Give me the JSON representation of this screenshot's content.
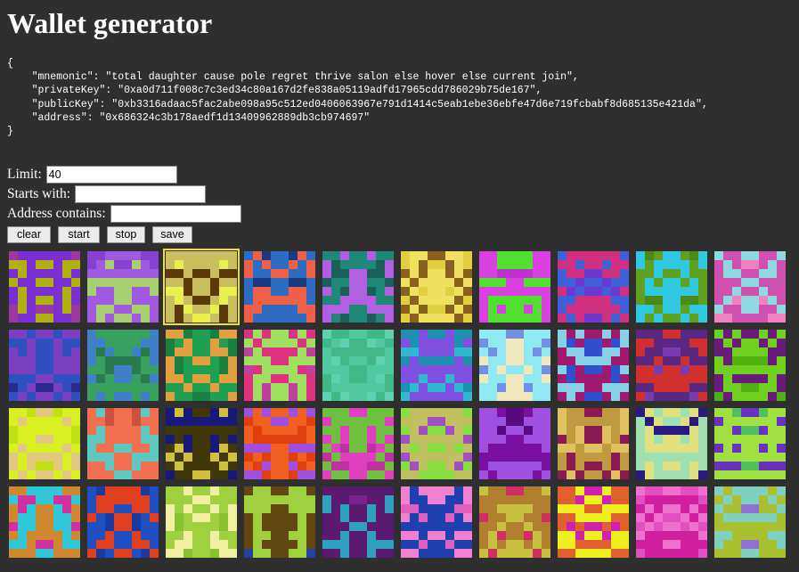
{
  "title": "Wallet generator",
  "wallet": {
    "mnemonic": "total daughter cause pole regret thrive salon else hover else current join",
    "privateKey": "0xa0d711f008c7c3ed34c80a167d2fe838a05119adfd17965cdd786029b75de167",
    "publicKey": "0xb3316adaac5fac2abe098a95c512ed0406063967e791d1414c5eab1ebe36ebfe47d6e719fcbabf8d685135e421da",
    "address": "0x686324c3b178aedf1d13409962889db3cb974697"
  },
  "form": {
    "limit_label": "Limit:",
    "limit_value": "40",
    "starts_label": "Starts with:",
    "starts_value": "",
    "contains_label": "Address contains:",
    "contains_value": ""
  },
  "buttons": {
    "clear": "clear",
    "start": "start",
    "stop": "stop",
    "save": "save"
  },
  "identicons": {
    "selected_index": 2,
    "selected_color": "#f0e020",
    "tiles": [
      {
        "c": [
          "#7a2fd0",
          "#b0b010",
          "#9a3aa0"
        ]
      },
      {
        "c": [
          "#a05ae0",
          "#a8d070",
          "#8840d0"
        ]
      },
      {
        "c": [
          "#c8c060",
          "#5a3a08",
          "#e8f050"
        ]
      },
      {
        "c": [
          "#2d6cc0",
          "#f06048",
          "#1a3a80"
        ]
      },
      {
        "c": [
          "#208878",
          "#b060e0",
          "#1a6058"
        ]
      },
      {
        "c": [
          "#e0d040",
          "#f0e060",
          "#8a6020"
        ]
      },
      {
        "c": [
          "#d840e0",
          "#50e030",
          "#c030d0"
        ]
      },
      {
        "c": [
          "#4060d8",
          "#d03080",
          "#6a3ad0"
        ]
      },
      {
        "c": [
          "#60a020",
          "#30c8e0",
          "#4a8a18"
        ]
      },
      {
        "c": [
          "#d050b0",
          "#90d8e0",
          "#f080c0"
        ]
      },
      {
        "c": [
          "#3050c0",
          "#7a40c0",
          "#2a2a90"
        ]
      },
      {
        "c": [
          "#3aa060",
          "#4080c8",
          "#2a7a50"
        ]
      },
      {
        "c": [
          "#20a050",
          "#e0a040",
          "#1a8040"
        ]
      },
      {
        "c": [
          "#a0e060",
          "#e03080",
          "#c040a0"
        ]
      },
      {
        "c": [
          "#50c8a0",
          "#40b888",
          "#60d0b0"
        ]
      },
      {
        "c": [
          "#30b8d0",
          "#8050e0",
          "#2090b0"
        ]
      },
      {
        "c": [
          "#90e8f0",
          "#f0e8c0",
          "#7090e0"
        ]
      },
      {
        "c": [
          "#88d0e8",
          "#a01870",
          "#3050d0"
        ]
      },
      {
        "c": [
          "#5a2880",
          "#d03030",
          "#7a3ab0"
        ]
      },
      {
        "c": [
          "#70d020",
          "#6a1a7a",
          "#50b010"
        ]
      },
      {
        "c": [
          "#d8f020",
          "#e0c880",
          "#c0e010"
        ]
      },
      {
        "c": [
          "#f07050",
          "#60c8c0",
          "#d05040"
        ]
      },
      {
        "c": [
          "#403808",
          "#181878",
          "#d0c040"
        ]
      },
      {
        "c": [
          "#f06020",
          "#a050e0",
          "#e04010"
        ]
      },
      {
        "c": [
          "#e040c0",
          "#70c040",
          "#c030a0"
        ]
      },
      {
        "c": [
          "#c0c060",
          "#88e040",
          "#a050c0"
        ]
      },
      {
        "c": [
          "#7a10a0",
          "#a050e0",
          "#5a0a80"
        ]
      },
      {
        "c": [
          "#c09a40",
          "#8a1a50",
          "#e0c060"
        ]
      },
      {
        "c": [
          "#a0e0b0",
          "#e0e080",
          "#2a1a80"
        ]
      },
      {
        "c": [
          "#a0e040",
          "#6a30c0",
          "#50c060"
        ]
      },
      {
        "c": [
          "#d08830",
          "#30c8d8",
          "#d030a0"
        ]
      },
      {
        "c": [
          "#2050c0",
          "#e04020",
          "#1a3aa0"
        ]
      },
      {
        "c": [
          "#a0d040",
          "#f0f0a0",
          "#88c030"
        ]
      },
      {
        "c": [
          "#604810",
          "#a0d040",
          "#2a40a0"
        ]
      },
      {
        "c": [
          "#5a1a70",
          "#30a0c0",
          "#7a2090"
        ]
      },
      {
        "c": [
          "#f080d0",
          "#2040b0",
          "#e060c0"
        ]
      },
      {
        "c": [
          "#b08030",
          "#c8c040",
          "#d03060"
        ]
      },
      {
        "c": [
          "#f0f020",
          "#e06030",
          "#d020b0"
        ]
      },
      {
        "c": [
          "#d020a0",
          "#f070d0",
          "#e050c0"
        ]
      },
      {
        "c": [
          "#a8c030",
          "#80d0c0",
          "#9070d0"
        ]
      }
    ]
  }
}
